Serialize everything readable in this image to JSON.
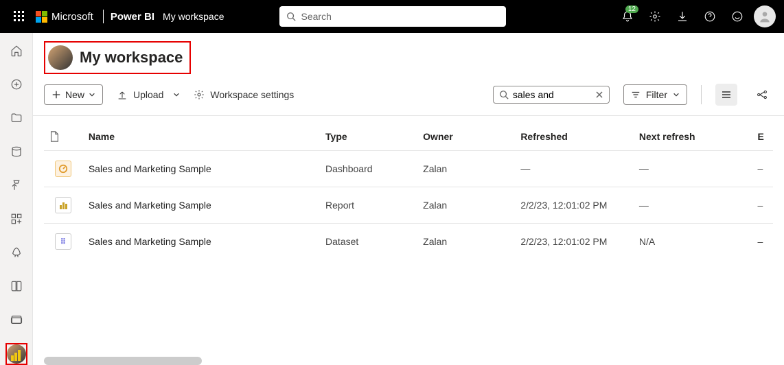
{
  "header": {
    "company": "Microsoft",
    "product": "Power BI",
    "breadcrumb": "My workspace",
    "search_placeholder": "Search",
    "notification_count": "12"
  },
  "workspace": {
    "title": "My workspace"
  },
  "toolbar": {
    "new_label": "New",
    "upload_label": "Upload",
    "settings_label": "Workspace settings",
    "search_value": "sales and",
    "filter_label": "Filter"
  },
  "columns": {
    "name": "Name",
    "type": "Type",
    "owner": "Owner",
    "refreshed": "Refreshed",
    "next_refresh": "Next refresh",
    "extra": "E"
  },
  "items": [
    {
      "icon": "dashboard",
      "name": "Sales and Marketing Sample",
      "type": "Dashboard",
      "owner": "Zalan",
      "refreshed": "—",
      "next_refresh": "—",
      "extra": "–"
    },
    {
      "icon": "report",
      "name": "Sales and Marketing Sample",
      "type": "Report",
      "owner": "Zalan",
      "refreshed": "2/2/23, 12:01:02 PM",
      "next_refresh": "—",
      "extra": "–"
    },
    {
      "icon": "dataset",
      "name": "Sales and Marketing Sample",
      "type": "Dataset",
      "owner": "Zalan",
      "refreshed": "2/2/23, 12:01:02 PM",
      "next_refresh": "N/A",
      "extra": "–"
    }
  ]
}
